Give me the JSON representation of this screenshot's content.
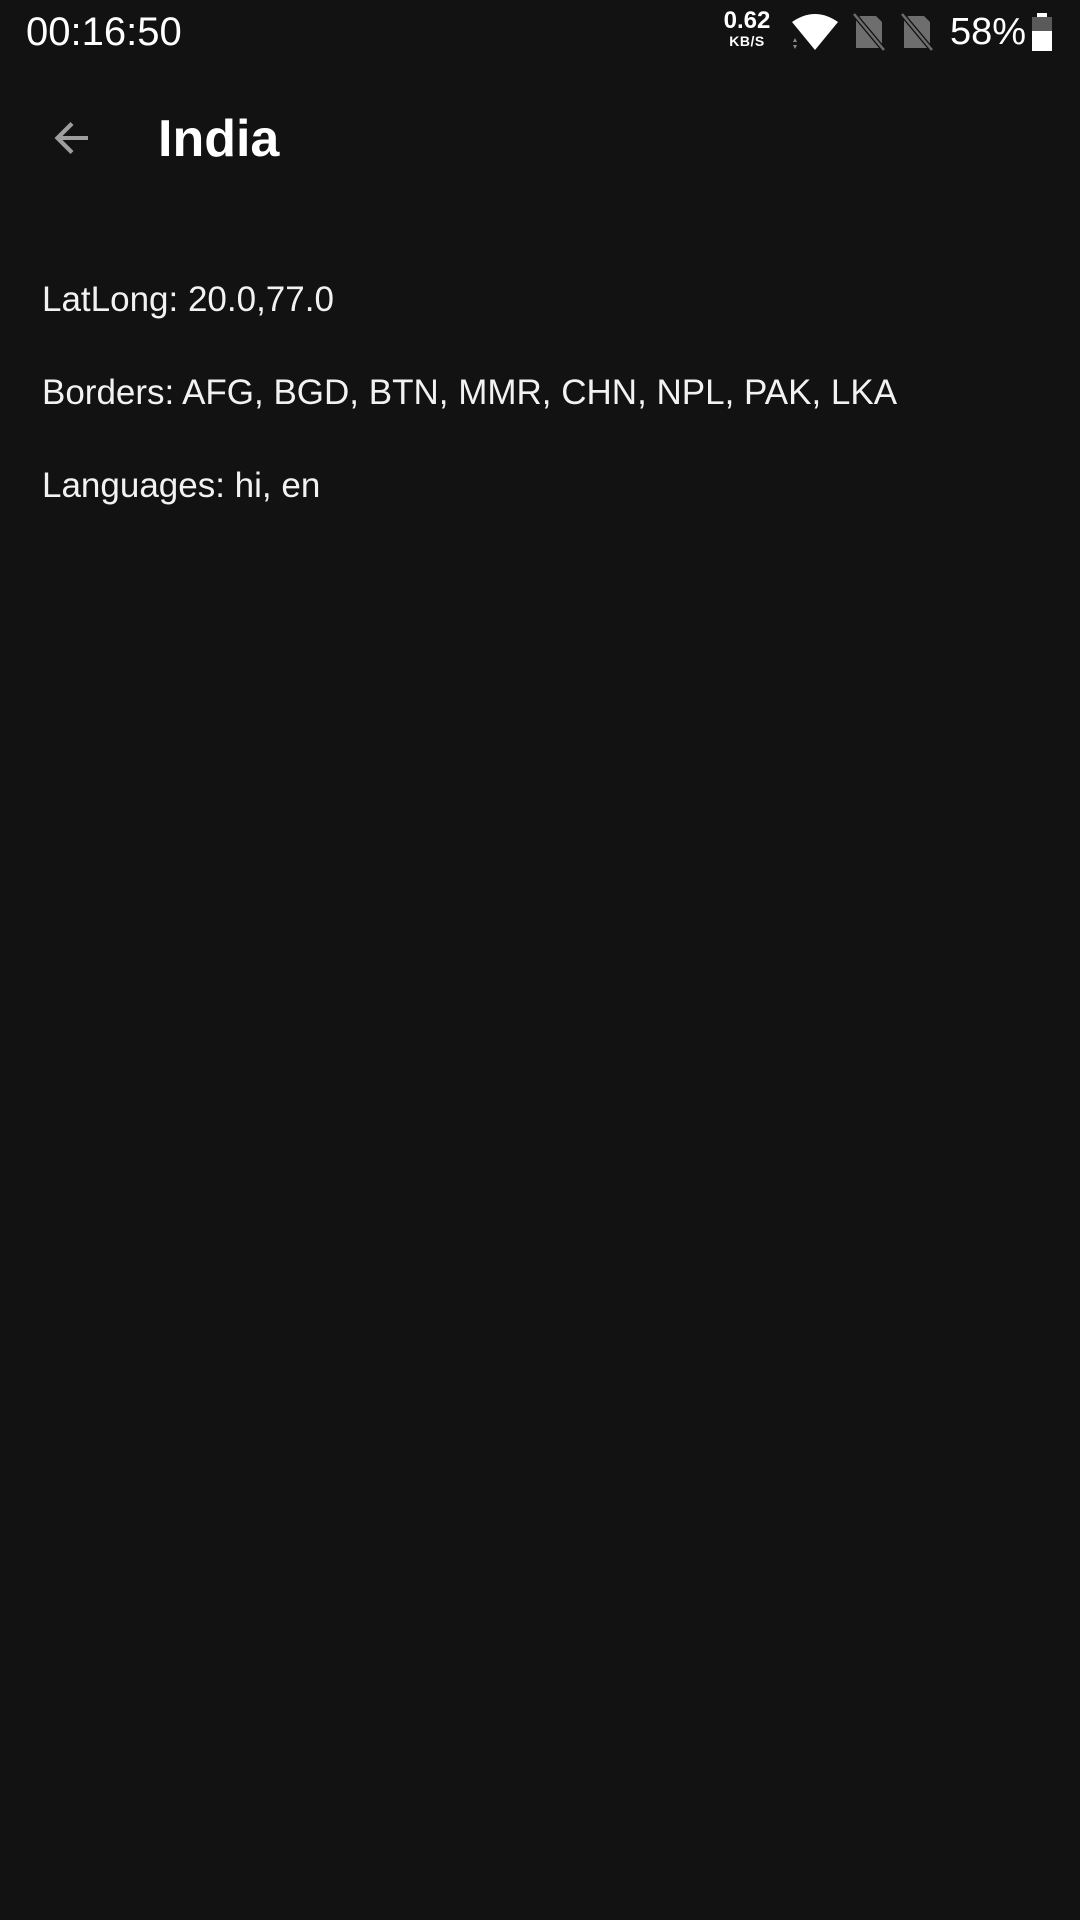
{
  "status_bar": {
    "time": "00:16:50",
    "net_speed_value": "0.62",
    "net_speed_unit": "KB/S",
    "battery_percent": "58%",
    "icons": [
      "wifi-icon",
      "no-sim-icon",
      "no-sim-icon",
      "battery-icon"
    ]
  },
  "app_bar": {
    "back_icon": "arrow-back-icon",
    "title": "India"
  },
  "details": {
    "latlong": "LatLong: 20.0,77.0",
    "borders": "Borders: AFG, BGD, BTN, MMR, CHN, NPL, PAK, LKA",
    "languages": "Languages: hi, en"
  },
  "colors": {
    "background": "#121212",
    "text": "#ffffff",
    "icon_muted": "#9e9e9e"
  }
}
